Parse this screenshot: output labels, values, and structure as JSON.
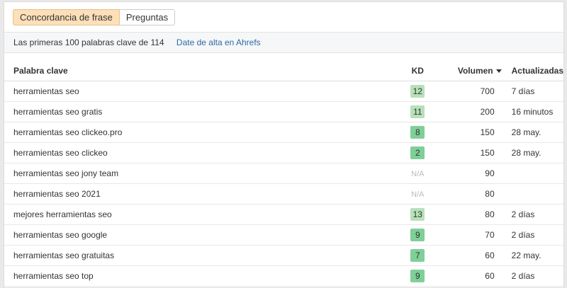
{
  "tabs": [
    {
      "label": "Concordancia de frase",
      "active": true
    },
    {
      "label": "Preguntas",
      "active": false
    }
  ],
  "infobar": {
    "count_text": "Las primeras 100 palabras clave de 114",
    "link_text": "Date de alta en Ahrefs"
  },
  "table": {
    "headers": {
      "keyword": "Palabra clave",
      "kd": "KD",
      "volume": "Volumen",
      "updated": "Actualizadas"
    },
    "rows": [
      {
        "keyword": "herramientas seo",
        "kd": "12",
        "volume": "700",
        "updated": "7 días"
      },
      {
        "keyword": "herramientas seo gratis",
        "kd": "11",
        "volume": "200",
        "updated": "16 minutos"
      },
      {
        "keyword": "herramientas seo clickeo.pro",
        "kd": "8",
        "volume": "150",
        "updated": "28 may."
      },
      {
        "keyword": "herramientas seo clickeo",
        "kd": "2",
        "volume": "150",
        "updated": "28 may."
      },
      {
        "keyword": "herramientas seo jony team",
        "kd": "N/A",
        "volume": "90",
        "updated": ""
      },
      {
        "keyword": "herramientas seo 2021",
        "kd": "N/A",
        "volume": "80",
        "updated": ""
      },
      {
        "keyword": "mejores herramientas seo",
        "kd": "13",
        "volume": "80",
        "updated": "2 días"
      },
      {
        "keyword": "herramientas seo google",
        "kd": "9",
        "volume": "70",
        "updated": "2 días"
      },
      {
        "keyword": "herramientas seo gratuitas",
        "kd": "7",
        "volume": "60",
        "updated": "22 may."
      },
      {
        "keyword": "herramientas seo top",
        "kd": "9",
        "volume": "60",
        "updated": "2 días"
      }
    ]
  },
  "colors": {
    "active_tab_bg": "#fddfb9",
    "kd_light_green": "#b7e1b9",
    "kd_medium_green": "#7fcf98",
    "link_blue": "#2d6aa3",
    "na_gray": "#bbbbbb"
  },
  "icons": {
    "sort": "caret-down-icon"
  }
}
